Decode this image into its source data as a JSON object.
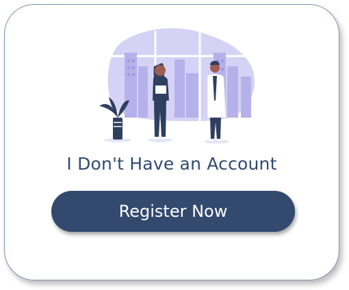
{
  "card": {
    "headline": "I Don't Have an Account",
    "register_button_label": "Register Now"
  },
  "illustration": {
    "icon": "doctors-illustration",
    "colors": {
      "blob": "#d6d2f5",
      "buildings": "#b6b1ea",
      "figure_dark": "#2f3f5e",
      "accent": "#6c63ff"
    }
  },
  "colors": {
    "primary": "#33496e",
    "text": "#2f4a70",
    "card_border": "#7a90b3"
  }
}
